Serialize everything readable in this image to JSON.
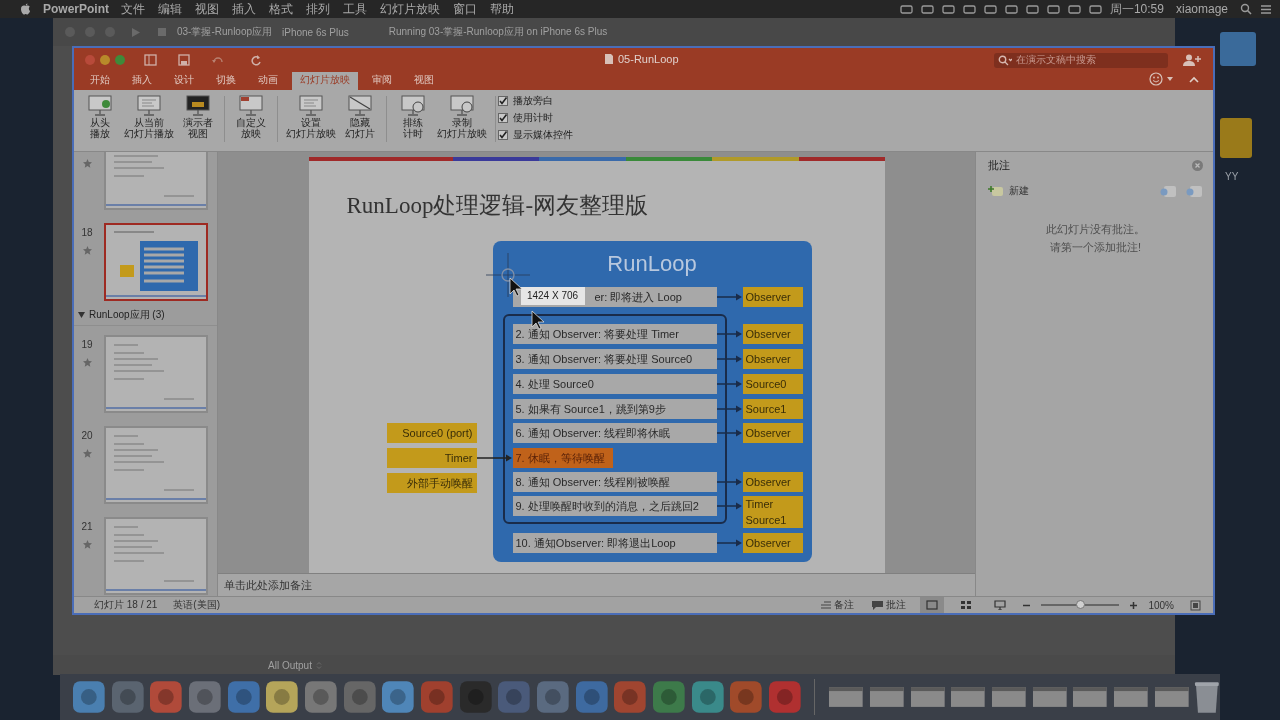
{
  "menu_bar": {
    "app": "PowerPoint",
    "menus": [
      "文件",
      "编辑",
      "视图",
      "插入",
      "格式",
      "排列",
      "工具",
      "幻灯片放映",
      "窗口",
      "帮助"
    ],
    "clock": "周一10:59",
    "user": "xiaomage"
  },
  "background_window": {
    "scheme": "03-掌握-Runloop应用",
    "device": "iPhone 6s Plus",
    "status": "Running 03-掌握-Runloop应用 on iPhone 6s Plus",
    "output_filter": "All Output"
  },
  "desktop": {
    "folder_label": "YY"
  },
  "window": {
    "title": "05-RunLoop",
    "search": {
      "placeholder": "在演示文稿中搜索"
    }
  },
  "tabs": [
    {
      "label": "开始",
      "selected": false
    },
    {
      "label": "插入",
      "selected": false
    },
    {
      "label": "设计",
      "selected": false
    },
    {
      "label": "切换",
      "selected": false
    },
    {
      "label": "动画",
      "selected": false
    },
    {
      "label": "幻灯片放映",
      "selected": true
    },
    {
      "label": "审阅",
      "selected": false
    },
    {
      "label": "视图",
      "selected": false
    }
  ],
  "ribbon": {
    "groups": [
      [
        {
          "lines": [
            "从头",
            "播放"
          ]
        },
        {
          "lines": [
            "从当前",
            "幻灯片播放"
          ]
        },
        {
          "lines": [
            "演示者",
            "视图"
          ]
        }
      ],
      [
        {
          "lines": [
            "自定义",
            "放映"
          ]
        }
      ],
      [
        {
          "lines": [
            "设置",
            "幻灯片放映"
          ]
        },
        {
          "lines": [
            "隐藏",
            "幻灯片"
          ]
        }
      ],
      [
        {
          "lines": [
            "排练",
            "计时"
          ]
        },
        {
          "lines": [
            "录制",
            "幻灯片放映"
          ]
        }
      ]
    ],
    "checkboxes": [
      {
        "label": "播放旁白",
        "checked": true
      },
      {
        "label": "使用计时",
        "checked": true
      },
      {
        "label": "显示媒体控件",
        "checked": true
      }
    ]
  },
  "thumbnails": [
    {
      "kind": "slide",
      "selected": false
    },
    {
      "kind": "slide",
      "number": "18",
      "selected": true
    },
    {
      "kind": "section",
      "label": "RunLoop应用 (3)",
      "expanded": true
    },
    {
      "kind": "slide",
      "number": "19",
      "selected": false
    },
    {
      "kind": "slide",
      "number": "20",
      "selected": false
    },
    {
      "kind": "slide",
      "number": "21",
      "selected": false
    }
  ],
  "slide": {
    "title": "RunLoop处理逻辑-网友整理版",
    "diagram": {
      "heading": "RunLoop",
      "steps": [
        {
          "text": "er: 即将进入 Loop",
          "kind": "normal",
          "target": [
            "Observer"
          ]
        },
        {
          "text": "2. 通知 Observer: 将要处理 Timer",
          "kind": "normal",
          "target": [
            "Observer"
          ]
        },
        {
          "text": "3. 通知 Observer: 将要处理 Source0",
          "kind": "normal",
          "target": [
            "Observer"
          ]
        },
        {
          "text": "4. 处理 Source0",
          "kind": "normal",
          "target": [
            "Source0"
          ]
        },
        {
          "text": "5. 如果有 Source1，跳到第9步",
          "kind": "normal",
          "target": [
            "Source1"
          ]
        },
        {
          "text": "6. 通知 Observer: 线程即将休眠",
          "kind": "normal",
          "target": [
            "Observer"
          ]
        },
        {
          "text": "7. 休眠，等待唤醒",
          "kind": "active"
        },
        {
          "text": "8. 通知 Observer: 线程刚被唤醒",
          "kind": "normal",
          "target": [
            "Observer"
          ]
        },
        {
          "text": "9. 处理唤醒时收到的消息，之后跳回2",
          "kind": "normal",
          "target": [
            "Timer",
            "Source1"
          ]
        },
        {
          "text": "10. 通知Observer: 即将退出Loop",
          "kind": "normal",
          "target": [
            "Observer"
          ]
        }
      ],
      "inputs": [
        "Source0 (port)",
        "Timer",
        "外部手动唤醒"
      ]
    }
  },
  "overlay": {
    "size_label": "1424 X 706"
  },
  "notes": {
    "placeholder": "单击此处添加备注"
  },
  "comments": {
    "title": "批注",
    "new": "新建",
    "empty": [
      "此幻灯片没有批注。",
      "请第一个添加批注!"
    ]
  },
  "status_bar": {
    "slide": "幻灯片 18 / 21",
    "language": "英语(美国)",
    "notes": "备注",
    "comments": "批注",
    "views": [
      {
        "selected": true
      },
      {
        "selected": false
      },
      {
        "selected": false
      }
    ],
    "zoom": {
      "level": 0.5,
      "label": "100%"
    }
  }
}
